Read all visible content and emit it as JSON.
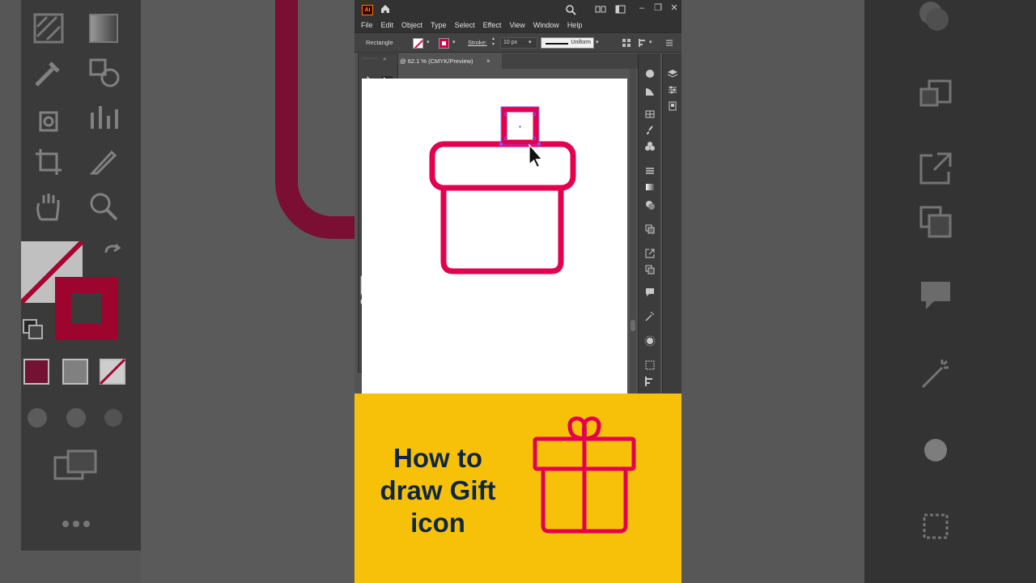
{
  "app": {
    "logo_text": "Ai",
    "window_controls": [
      "–",
      "❐",
      "✕"
    ]
  },
  "menu": [
    "File",
    "Edit",
    "Object",
    "Type",
    "Select",
    "Effect",
    "View",
    "Window",
    "Help"
  ],
  "control_bar": {
    "selection_label": "Rectangle",
    "stroke_label": "Stroke:",
    "stroke_width": "10 px",
    "profile": "Uniform"
  },
  "document": {
    "tab_title": "@ 62.1 % (CMYK/Preview)",
    "close_glyph": "×"
  },
  "colors": {
    "accent": "#e2004f",
    "banner": "#f7c10a",
    "banner_text": "#0d2740",
    "ui_dark": "#323232",
    "ui_mid": "#424242"
  },
  "banner": {
    "line1": "How to",
    "line2": "draw Gift",
    "line3": "icon"
  },
  "tools_more": "•••"
}
